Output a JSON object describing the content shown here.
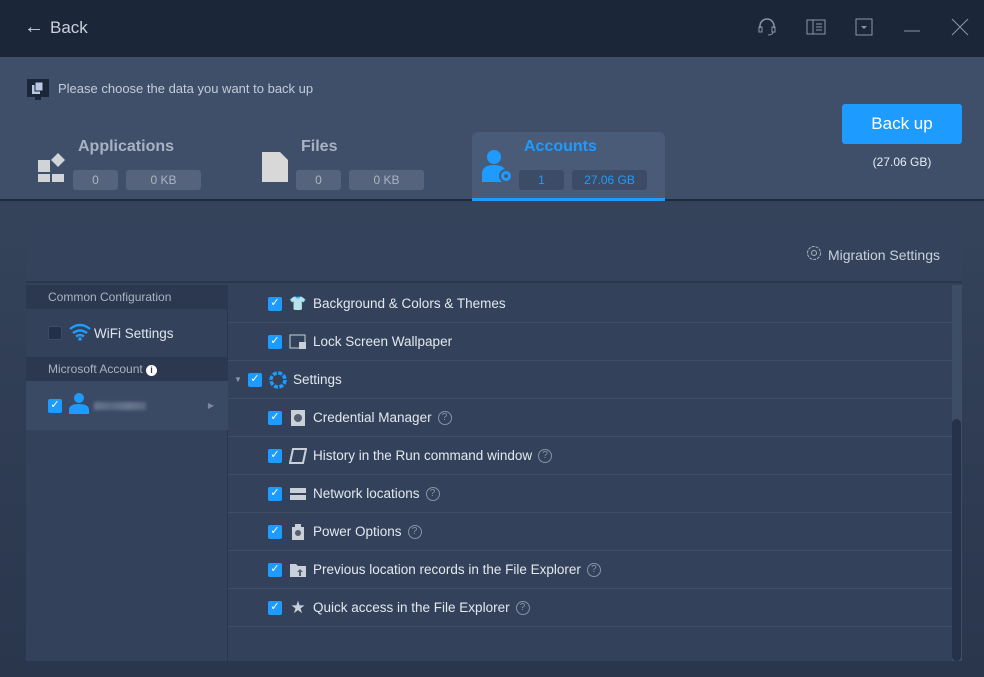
{
  "titlebar": {
    "back_label": "Back",
    "icons": [
      "headset-icon",
      "manual-icon",
      "menu-dropdown-icon",
      "minimize-icon",
      "close-icon"
    ]
  },
  "header": {
    "prompt": "Please choose the data you want to back up",
    "tabs": [
      {
        "label": "Applications",
        "count": "0",
        "size": "0 KB"
      },
      {
        "label": "Files",
        "count": "0",
        "size": "0 KB"
      },
      {
        "label": "Accounts",
        "count": "1",
        "size": "27.06 GB",
        "active": true
      }
    ],
    "backup_label": "Back up",
    "backup_size": "(27.06 GB)"
  },
  "panel": {
    "migration_settings": "Migration Settings",
    "left": {
      "common_header": "Common Configuration",
      "wifi_label": "WiFi Settings",
      "ms_header": "Microsoft Account"
    },
    "items": [
      {
        "label": "Background & Colors & Themes",
        "checked": true
      },
      {
        "label": "Lock Screen Wallpaper",
        "checked": true
      },
      {
        "label": "Settings",
        "checked": true
      },
      {
        "label": "Credential Manager",
        "checked": true,
        "help": "?"
      },
      {
        "label": "History in the Run command window",
        "checked": true,
        "help": "?"
      },
      {
        "label": "Network locations",
        "checked": true,
        "help": "?"
      },
      {
        "label": "Power Options",
        "checked": true,
        "help": "?"
      },
      {
        "label": "Previous location records in the File Explorer",
        "checked": true,
        "help": "?"
      },
      {
        "label": "Quick access in the File Explorer",
        "checked": true,
        "help": "?"
      }
    ]
  },
  "colors": {
    "accent": "#1e9bff",
    "titlebar": "#1c2639",
    "header": "#3f4f6a",
    "panel": "#33425a"
  }
}
